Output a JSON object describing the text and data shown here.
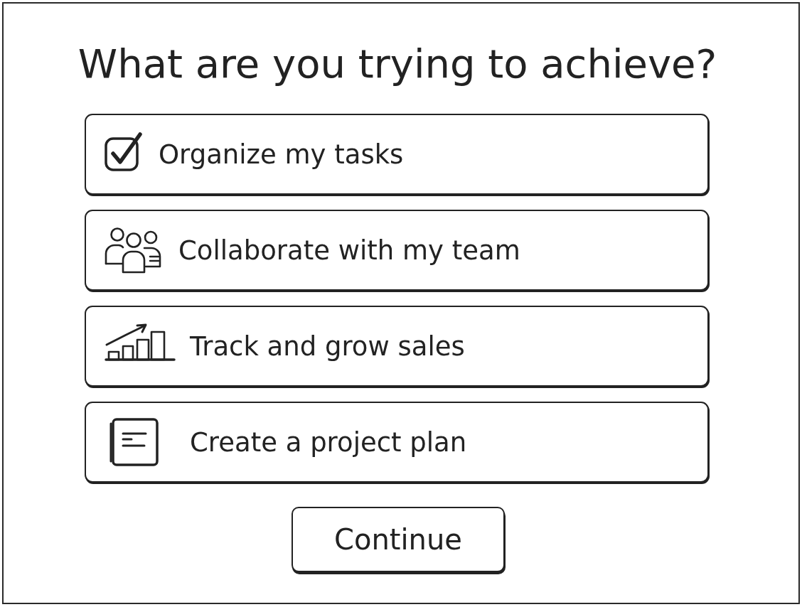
{
  "title": "What are you trying to achieve?",
  "options": [
    {
      "label": "Organize my tasks",
      "selected": false
    },
    {
      "label": "Collaborate with my team",
      "selected": false
    },
    {
      "label": "Track and grow sales",
      "selected": false
    },
    {
      "label": "Create a project plan",
      "selected": false
    }
  ],
  "continue_button": {
    "label": "Continue"
  }
}
